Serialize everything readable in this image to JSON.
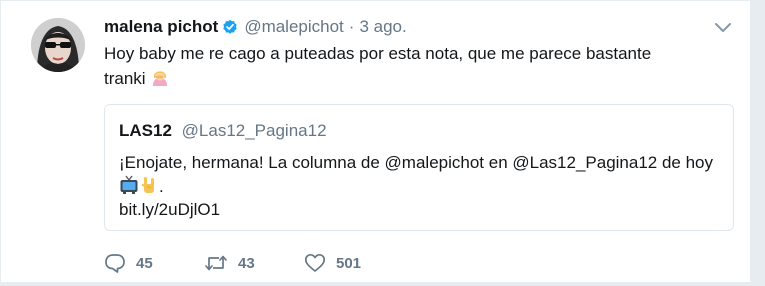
{
  "tweet": {
    "fullname": "malena pichot",
    "handle": "@malepichot",
    "separator": "·",
    "time": "3 ago.",
    "text_line1": "Hoy baby me re cago a puteadas por esta nota, que me parece bastante",
    "text_line2": "tranki",
    "text_emoji": "person-facepalming-emoji"
  },
  "quote": {
    "name": "LAS12",
    "handle": "@Las12_Pagina12",
    "text_line1": "¡Enojate, hermana! La columna de @malepichot en @Las12_Pagina12 de hoy",
    "text_end": ".",
    "emojis": [
      "television-emoji",
      "rock-on-hand-emoji"
    ],
    "link": "bit.ly/2uDjlO1"
  },
  "actions": {
    "replies": "45",
    "retweets": "43",
    "likes": "501"
  },
  "icons": {
    "verified": "verified-badge-icon",
    "caret": "chevron-down-icon",
    "reply": "reply-icon",
    "retweet": "retweet-icon",
    "like": "heart-icon"
  },
  "colors": {
    "accent": "#1da1f2",
    "text": "#14171a",
    "muted": "#657786",
    "border": "#e1e8ed",
    "background": "#e6ecf0"
  }
}
